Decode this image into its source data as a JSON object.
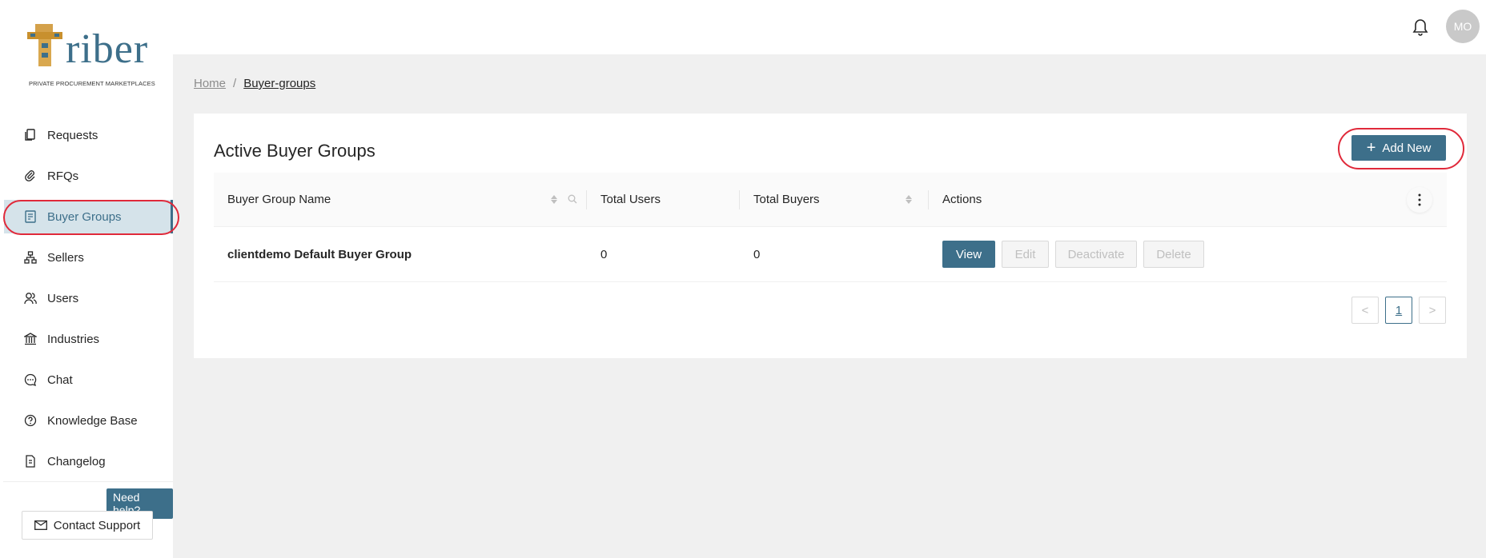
{
  "brand": {
    "logo_word": "riber",
    "tagline": "PRIVATE PROCUREMENT MARKETPLACES",
    "accent_color": "#3d6f8a"
  },
  "sidebar": {
    "items": [
      {
        "label": "Requests",
        "icon": "copy-icon"
      },
      {
        "label": "RFQs",
        "icon": "paperclip-icon"
      },
      {
        "label": "Buyer Groups",
        "icon": "list-document-icon",
        "active": true
      },
      {
        "label": "Sellers",
        "icon": "sitemap-icon"
      },
      {
        "label": "Users",
        "icon": "users-icon"
      },
      {
        "label": "Industries",
        "icon": "bank-icon"
      },
      {
        "label": "Chat",
        "icon": "chat-bubble-icon"
      },
      {
        "label": "Knowledge Base",
        "icon": "question-circle-icon"
      },
      {
        "label": "Changelog",
        "icon": "file-icon"
      }
    ],
    "need_help": "Need help?",
    "contact_support": "Contact Support"
  },
  "header": {
    "avatar_initials": "MO"
  },
  "breadcrumb": {
    "home": "Home",
    "separator": "/",
    "current": "Buyer-groups"
  },
  "card": {
    "title": "Active Buyer Groups",
    "add_new_label": "Add New"
  },
  "table": {
    "columns": [
      "Buyer Group Name",
      "Total Users",
      "Total Buyers",
      "Actions"
    ],
    "rows": [
      {
        "name": "clientdemo Default Buyer Group",
        "total_users": "0",
        "total_buyers": "0"
      }
    ],
    "actions": {
      "view": "View",
      "edit": "Edit",
      "deactivate": "Deactivate",
      "delete": "Delete"
    }
  },
  "pagination": {
    "current_page": "1",
    "prev": "<",
    "next": ">"
  }
}
